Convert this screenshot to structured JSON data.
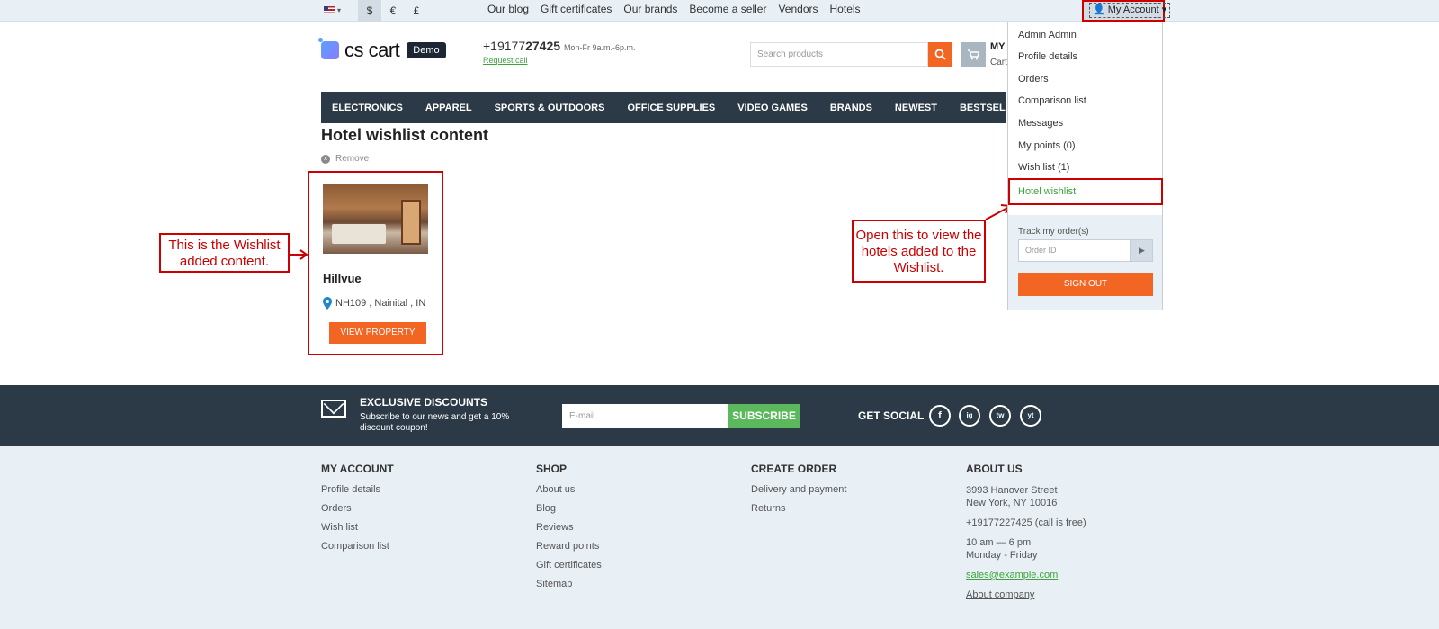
{
  "topbar": {
    "currencies": [
      "$",
      "€",
      "£"
    ],
    "links": [
      "Our blog",
      "Gift certificates",
      "Our brands",
      "Become a seller",
      "Vendors",
      "Hotels"
    ],
    "my_account": "My Account"
  },
  "header": {
    "logo": "cs cart",
    "demo_badge": "Demo",
    "phone_prefix": "+19177",
    "phone_bold": "27425",
    "hours": "Mon-Fr 9a.m.-6p.m.",
    "request_call": "Request call",
    "search_placeholder": "Search products",
    "cart_title": "MY",
    "cart_sub": "Cart"
  },
  "nav": [
    "ELECTRONICS",
    "APPAREL",
    "SPORTS & OUTDOORS",
    "OFFICE SUPPLIES",
    "VIDEO GAMES",
    "BRANDS",
    "NEWEST",
    "BESTSELLERS"
  ],
  "main": {
    "title": "Hotel wishlist content",
    "remove": "Remove",
    "hotel": {
      "name": "Hillvue",
      "location": "NH109 , Nainital , IN",
      "button": "VIEW PROPERTY"
    }
  },
  "callouts": {
    "left": "This is the Wishlist added content.",
    "right": "Open this to view the hotels added to the Wishlist."
  },
  "dropdown": {
    "items": [
      "Admin Admin",
      "Profile details",
      "Orders",
      "Comparison list",
      "Messages",
      "My points (0)",
      "Wish list (1)"
    ],
    "highlighted": "Hotel wishlist",
    "track_label": "Track my order(s)",
    "order_placeholder": "Order ID",
    "sign_out": "SIGN OUT"
  },
  "newsletter": {
    "title": "EXCLUSIVE DISCOUNTS",
    "subtitle": "Subscribe to our news and get a 10% discount coupon!",
    "email_placeholder": "E-mail",
    "subscribe": "SUBSCRIBE",
    "social_label": "GET SOCIAL",
    "social": [
      "f",
      "ig",
      "tw",
      "yt"
    ]
  },
  "footer": {
    "my_account": {
      "title": "MY ACCOUNT",
      "links": [
        "Profile details",
        "Orders",
        "Wish list",
        "Comparison list"
      ]
    },
    "shop": {
      "title": "SHOP",
      "links": [
        "About us",
        "Blog",
        "Reviews",
        "Reward points",
        "Gift certificates",
        "Sitemap"
      ]
    },
    "create_order": {
      "title": "CREATE ORDER",
      "links": [
        "Delivery and payment",
        "Returns"
      ]
    },
    "about": {
      "title": "ABOUT US",
      "address1": "3993 Hanover Street",
      "address2": "New York, NY 10016",
      "phone": "+19177227425 (call is free)",
      "hours1": "10 am — 6 pm",
      "hours2": "Monday - Friday",
      "email": "sales@example.com",
      "company": "About company"
    }
  },
  "colors": {
    "accent": "#f26522",
    "nav": "#2b3a46",
    "green": "#3da33d",
    "annotation": "#cc0000"
  }
}
